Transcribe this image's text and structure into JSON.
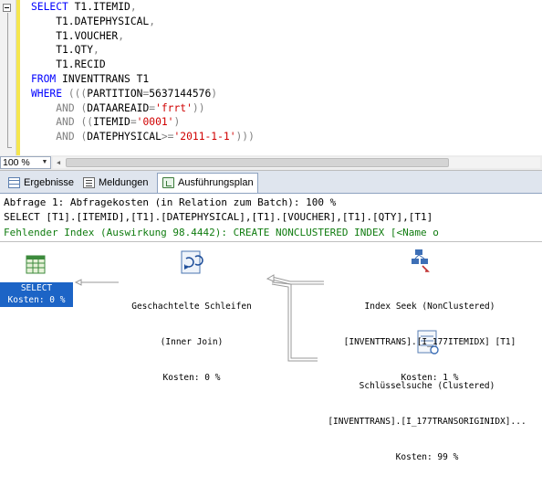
{
  "editor": {
    "lines": [
      [
        {
          "t": "SELECT ",
          "c": "kw"
        },
        {
          "t": "T1.ITEMID",
          "c": "fn"
        },
        {
          "t": ",",
          "c": "gr"
        }
      ],
      [
        {
          "t": "    T1.DATEPHYSICAL",
          "c": "fn"
        },
        {
          "t": ",",
          "c": "gr"
        }
      ],
      [
        {
          "t": "    T1.VOUCHER",
          "c": "fn"
        },
        {
          "t": ",",
          "c": "gr"
        }
      ],
      [
        {
          "t": "    T1.QTY",
          "c": "fn"
        },
        {
          "t": ",",
          "c": "gr"
        }
      ],
      [
        {
          "t": "    T1.RECID",
          "c": "fn"
        }
      ],
      [
        {
          "t": "FROM ",
          "c": "kw"
        },
        {
          "t": "INVENTTRANS T1",
          "c": "fn"
        }
      ],
      [
        {
          "t": "WHERE ",
          "c": "kw"
        },
        {
          "t": "(((",
          "c": "gr"
        },
        {
          "t": "PARTITION",
          "c": "fn"
        },
        {
          "t": "=",
          "c": "gr"
        },
        {
          "t": "5637144576",
          "c": "fn"
        },
        {
          "t": ")",
          "c": "gr"
        }
      ],
      [
        {
          "t": "    ",
          "c": "fn"
        },
        {
          "t": "AND ",
          "c": "gr"
        },
        {
          "t": "(",
          "c": "gr"
        },
        {
          "t": "DATAAREAID",
          "c": "fn"
        },
        {
          "t": "=",
          "c": "gr"
        },
        {
          "t": "'frrt'",
          "c": "st"
        },
        {
          "t": "))",
          "c": "gr"
        }
      ],
      [
        {
          "t": "    ",
          "c": "fn"
        },
        {
          "t": "AND ",
          "c": "gr"
        },
        {
          "t": "((",
          "c": "gr"
        },
        {
          "t": "ITEMID",
          "c": "fn"
        },
        {
          "t": "=",
          "c": "gr"
        },
        {
          "t": "'0001'",
          "c": "st"
        },
        {
          "t": ")",
          "c": "gr"
        }
      ],
      [
        {
          "t": "    ",
          "c": "fn"
        },
        {
          "t": "AND ",
          "c": "gr"
        },
        {
          "t": "(",
          "c": "gr"
        },
        {
          "t": "DATEPHYSICAL",
          "c": "fn"
        },
        {
          "t": ">=",
          "c": "gr"
        },
        {
          "t": "'2011-1-1'",
          "c": "st"
        },
        {
          "t": ")))",
          "c": "gr"
        }
      ]
    ]
  },
  "zoom": {
    "value": "100 %"
  },
  "tabs": [
    {
      "label": "Ergebnisse",
      "icon": "grid-icon"
    },
    {
      "label": "Meldungen",
      "icon": "messages-icon"
    },
    {
      "label": "Ausführungsplan",
      "icon": "execution-plan-icon",
      "active": true
    }
  ],
  "plan_header": {
    "line1": "Abfrage 1: Abfragekosten (in Relation zum Batch): 100 %",
    "line2": "SELECT [T1].[ITEMID],[T1].[DATEPHYSICAL],[T1].[VOUCHER],[T1].[QTY],[T1]",
    "line3": "Fehlender Index (Auswirkung 98.4442): CREATE NONCLUSTERED INDEX [<Name o"
  },
  "plan": {
    "select": {
      "title": "SELECT",
      "cost": "Kosten: 0 %"
    },
    "nested_loops": {
      "title": "Geschachtelte Schleifen",
      "subtitle": "(Inner Join)",
      "cost": "Kosten: 0 %"
    },
    "index_seek": {
      "title": "Index Seek (NonClustered)",
      "object": "[INVENTTRANS].[I_177ITEMIDX] [T1]",
      "cost": "Kosten: 1 %"
    },
    "key_lookup": {
      "title": "Schlüsselsuche (Clustered)",
      "object": "[INVENTTRANS].[I_177TRANSORIGINIDX]...",
      "cost": "Kosten: 99 %"
    }
  },
  "colors": {
    "keyword": "#0000ff",
    "string": "#d00000",
    "operator": "#808080",
    "missing_index": "#107c10",
    "selected": "#1c64c6"
  }
}
